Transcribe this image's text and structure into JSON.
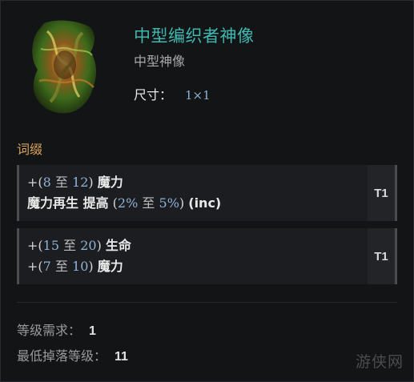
{
  "item": {
    "name": "中型编织者神像",
    "base_type": "中型神像",
    "size_label": "尺寸：",
    "size_value": "1×1",
    "art_icon": "woven-idol-icon"
  },
  "affixes": {
    "section_title": "词缀",
    "groups": [
      {
        "tier": "T1",
        "lines": [
          {
            "plus": "+",
            "open": "(",
            "min": "8",
            "to": "至",
            "max": "12",
            "close": ")",
            "stat": "魔力"
          },
          {
            "prefix": "魔力再生 提高",
            "open": "(",
            "min": "2%",
            "to": "至",
            "max": "5%",
            "close": ")",
            "suffix": "(inc)"
          }
        ]
      },
      {
        "tier": "T1",
        "lines": [
          {
            "plus": "+",
            "open": "(",
            "min": "15",
            "to": "至",
            "max": "20",
            "close": ")",
            "stat": "生命"
          },
          {
            "plus": "+",
            "open": "(",
            "min": "7",
            "to": "至",
            "max": "10",
            "close": ")",
            "stat": "魔力"
          }
        ]
      }
    ]
  },
  "requirements": {
    "level_label": "等级需求：",
    "level_value": "1",
    "drop_label": "最低掉落等级：",
    "drop_value": "11"
  },
  "watermark": "游侠网",
  "colors": {
    "name": "#3fb9b0",
    "section_title": "#d8a35a",
    "value_blue": "#8fb2d8",
    "background": "#131416"
  }
}
